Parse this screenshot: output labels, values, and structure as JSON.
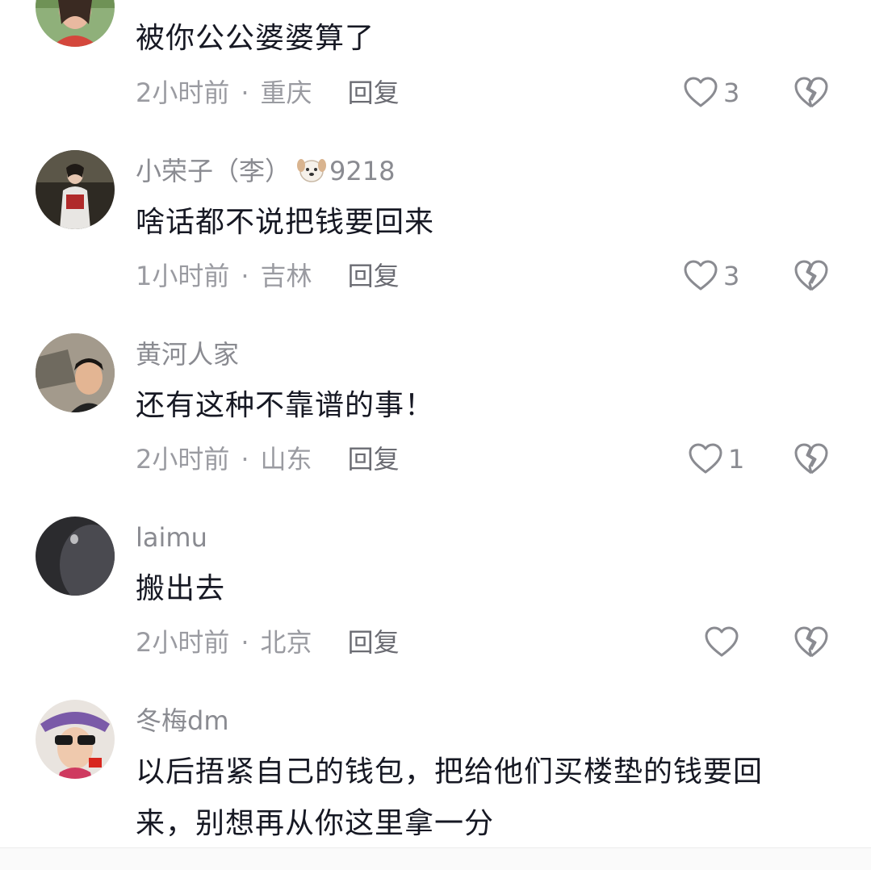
{
  "comments": [
    {
      "username": "",
      "content": "被你公公婆婆算了",
      "time": "2小时前",
      "location": "重庆",
      "reply_label": "回复",
      "likes": "3"
    },
    {
      "username": "小荣子（李）",
      "badge": "9218",
      "content": "啥话都不说把钱要回来",
      "time": "1小时前",
      "location": "吉林",
      "reply_label": "回复",
      "likes": "3"
    },
    {
      "username": "黄河人家",
      "content": "还有这种不靠谱的事！",
      "time": "2小时前",
      "location": "山东",
      "reply_label": "回复",
      "likes": "1"
    },
    {
      "username": "laimu",
      "content": "搬出去",
      "time": "2小时前",
      "location": "北京",
      "reply_label": "回复",
      "likes": ""
    },
    {
      "username": "冬梅dm",
      "content_line1": "以后捂紧自己的钱包，把给他们买楼垫的钱要回",
      "content_line2": "来，别想再从你这里拿一分"
    }
  ],
  "separator": "·",
  "icons": {
    "like": "heart-outline-icon",
    "dislike": "broken-heart-icon",
    "badge": "dog-emoji-icon"
  },
  "colors": {
    "text_primary": "#161823",
    "text_secondary": "#8a8b91",
    "icon_gray": "#8a8b91"
  }
}
